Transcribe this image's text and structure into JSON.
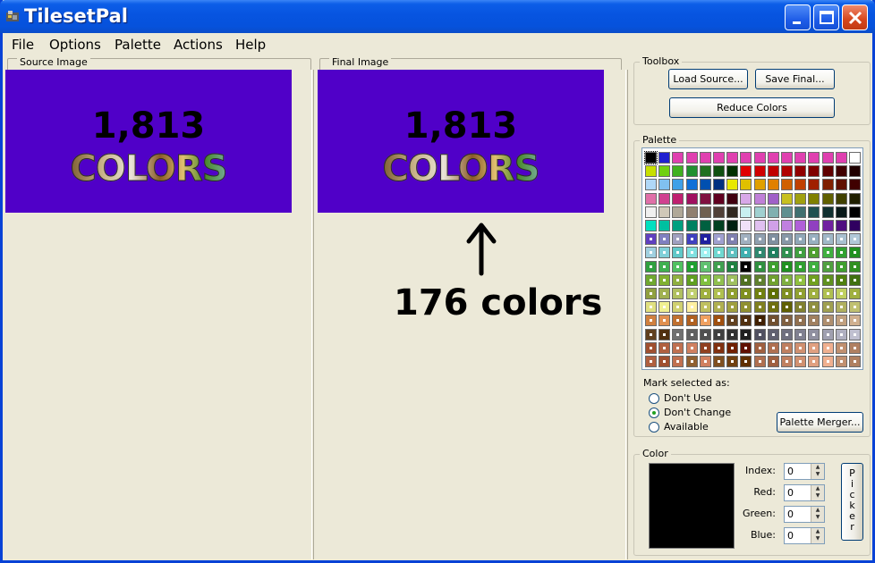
{
  "window": {
    "title": "TilesetPal"
  },
  "menu": [
    "File",
    "Options",
    "Palette",
    "Actions",
    "Help"
  ],
  "panels": {
    "source": {
      "label": "Source Image",
      "count": "1,813",
      "word": "COLORS"
    },
    "final": {
      "label": "Final Image",
      "count": "1,813",
      "word": "COLORS",
      "annotation": "176 colors"
    }
  },
  "toolbox": {
    "label": "Toolbox",
    "load_source": "Load Source...",
    "save_final": "Save Final...",
    "reduce_colors": "Reduce Colors"
  },
  "palette": {
    "label": "Palette",
    "mark_label": "Mark selected as:",
    "options": [
      "Don't Use",
      "Don't Change",
      "Available"
    ],
    "selected_option": "Don't Change",
    "merger_button": "Palette Merger...",
    "rows": [
      [
        "#000000",
        "#2020d0",
        "#e040b0",
        "#e040b0",
        "#e040b0",
        "#e040b0",
        "#e040b0",
        "#e040b0",
        "#e040b0",
        "#e040b0",
        "#e040b0",
        "#e040b0",
        "#e040b0",
        "#e040b0",
        "#e040b0",
        "#ffffff"
      ],
      [
        "#c8e000",
        "#70d010",
        "#40b020",
        "#209030",
        "#207020",
        "#105010",
        "#003000",
        "#e00000",
        "#d00000",
        "#c00000",
        "#b00000",
        "#900000",
        "#800000",
        "#600000",
        "#400000",
        "#200000"
      ],
      [
        "#b0d8f8",
        "#80c0f0",
        "#40a0e8",
        "#1070d8",
        "#0050b0",
        "#003080",
        "#e8e800",
        "#e0c000",
        "#e0a000",
        "#e08000",
        "#d06000",
        "#c04000",
        "#a02000",
        "#802000",
        "#601000",
        "#400000"
      ],
      [
        "#e070a8",
        "#d04090",
        "#c02070",
        "#a01060",
        "#801040",
        "#600020",
        "#400010",
        "#d8a8e8",
        "#c080d8",
        "#a060c8",
        "#c8c020",
        "#a0a010",
        "#808000",
        "#606000",
        "#404000",
        "#202000"
      ],
      [
        "#f0f0f0",
        "#d0c8b8",
        "#b0a898",
        "#908070",
        "#706050",
        "#504038",
        "#302820",
        "#c8f0f0",
        "#a0d0d0",
        "#80b0b0",
        "#609090",
        "#407070",
        "#205050",
        "#103030",
        "#081818",
        "#000000"
      ],
      [
        "#00e0c0",
        "#00c0a0",
        "#00a080",
        "#008060",
        "#006040",
        "#004020",
        "#002010",
        "#f0e0f8",
        "#e0c0f0",
        "#d0a0e8",
        "#c080e0",
        "#b060d8",
        "#9040c0",
        "#7020a0",
        "#501080",
        "#300060"
      ],
      [
        "#6040c0",
        "#8080c0",
        "#a0a0c0",
        "#4040c0",
        "#2020a0",
        "#a0a0d0",
        "#8080b0",
        "#a0b0c0",
        "#90a0b0",
        "#8090a0",
        "#8898a8",
        "#90a8b8",
        "#98b0c0",
        "#a0b8c8",
        "#a8c0d0",
        "#b0c8d8"
      ],
      [
        "#a0d0e0",
        "#80d0d8",
        "#60c8c8",
        "#80e0e0",
        "#a0f0f0",
        "#70d8d0",
        "#60c0c0",
        "#40b0b0",
        "#308870",
        "#208060",
        "#309050",
        "#40a040",
        "#50a030",
        "#40b040",
        "#30a030",
        "#209020"
      ],
      [
        "#30a040",
        "#40b050",
        "#50c060",
        "#20a030",
        "#60c070",
        "#40a050",
        "#208040",
        "#000000",
        "#309040",
        "#40a030",
        "#209020",
        "#30a030",
        "#40b040",
        "#50a040",
        "#40a030",
        "#309020"
      ],
      [
        "#70a830",
        "#80b030",
        "#90b040",
        "#60a020",
        "#80c040",
        "#90c050",
        "#a0c060",
        "#507020",
        "#608030",
        "#70a030",
        "#80b040",
        "#90c040",
        "#70a020",
        "#609020",
        "#508010",
        "#407010"
      ],
      [
        "#90a040",
        "#a0b050",
        "#b0c060",
        "#c0d070",
        "#a0b040",
        "#b0c050",
        "#90a030",
        "#809020",
        "#708010",
        "#607000",
        "#809020",
        "#90a030",
        "#a0b040",
        "#b0c050",
        "#c0d060",
        "#a0b040"
      ],
      [
        "#e0e080",
        "#f0f090",
        "#d0d070",
        "#fff0a0",
        "#c0c060",
        "#b0b050",
        "#a0a040",
        "#909030",
        "#808020",
        "#707010",
        "#606000",
        "#808030",
        "#909040",
        "#a0a050",
        "#b0b060",
        "#c0c070"
      ],
      [
        "#d08040",
        "#e09050",
        "#c07030",
        "#b06020",
        "#f0a060",
        "#a05010",
        "#604020",
        "#503010",
        "#402000",
        "#705030",
        "#806040",
        "#907050",
        "#a08060",
        "#b09070",
        "#c0a080",
        "#d0b090"
      ],
      [
        "#604020",
        "#503010",
        "#707070",
        "#606060",
        "#505050",
        "#404040",
        "#303030",
        "#202020",
        "#505060",
        "#606070",
        "#707080",
        "#808090",
        "#9090a0",
        "#a0a0b0",
        "#b0b0c0",
        "#c0c0d0"
      ],
      [
        "#a05030",
        "#b06040",
        "#c07050",
        "#d08060",
        "#904020",
        "#803010",
        "#702000",
        "#601000",
        "#a06040",
        "#b07050",
        "#c08060",
        "#d09070",
        "#e0a080",
        "#f0b090",
        "#c09070",
        "#b08060"
      ],
      [
        "#b06040",
        "#a05030",
        "#c07050",
        "#906030",
        "#d08060",
        "#805020",
        "#704010",
        "#603000",
        "#b07050",
        "#a06040",
        "#c08060",
        "#d09070",
        "#e0a080",
        "#f0b090",
        "#c09070",
        "#b08060"
      ]
    ]
  },
  "color": {
    "label": "Color",
    "swatch": "#000000",
    "fields": [
      {
        "label": "Index:",
        "value": "0"
      },
      {
        "label": "Red:",
        "value": "0"
      },
      {
        "label": "Green:",
        "value": "0"
      },
      {
        "label": "Blue:",
        "value": "0"
      }
    ],
    "picker_label": "Picker"
  },
  "colors": {
    "canvas_bg": "#5000c8",
    "title_blue": "#0754e0"
  }
}
